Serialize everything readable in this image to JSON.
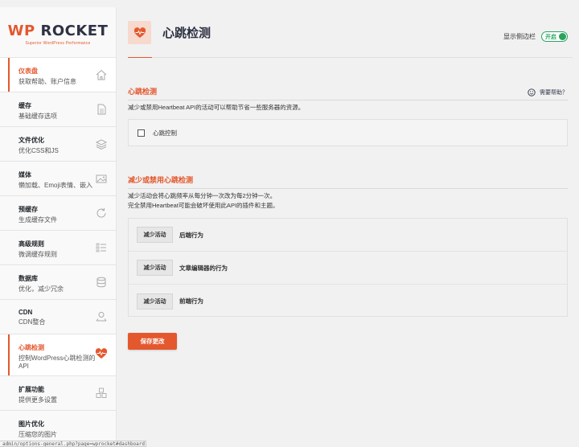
{
  "logo": {
    "main_wp": "WP",
    "main_rocket": "ROCKET",
    "sub": "Superior WordPress Performance"
  },
  "sidebar": {
    "items": [
      {
        "title": "仪表盘",
        "desc": "获取帮助、账户信息",
        "icon": "home-icon"
      },
      {
        "title": "缓存",
        "desc": "基础缓存选项",
        "icon": "file-icon"
      },
      {
        "title": "文件优化",
        "desc": "优化CSS和JS",
        "icon": "layers-icon"
      },
      {
        "title": "媒体",
        "desc": "懒加载、Emoji表情、嵌入",
        "icon": "image-icon"
      },
      {
        "title": "预缓存",
        "desc": "生成缓存文件",
        "icon": "refresh-icon"
      },
      {
        "title": "高级规则",
        "desc": "微调缓存规则",
        "icon": "list-icon"
      },
      {
        "title": "数据库",
        "desc": "优化，减少冗余",
        "icon": "database-icon"
      },
      {
        "title": "CDN",
        "desc": "CDN整合",
        "icon": "cdn-icon"
      },
      {
        "title": "心跳检测",
        "desc": "控制WordPress心跳检测的API",
        "icon": "heartbeat-icon"
      },
      {
        "title": "扩展功能",
        "desc": "提供更多设置",
        "icon": "addons-icon"
      },
      {
        "title": "图片优化",
        "desc": "压缩您的图片",
        "icon": ""
      }
    ]
  },
  "header": {
    "title": "心跳检测",
    "icon": "heartbeat-icon",
    "sidebar_toggle_label": "显示侧边栏",
    "sidebar_toggle_value": "开启"
  },
  "section1": {
    "title": "心跳检测",
    "help": "需要帮助？",
    "description": "减少或禁用Heartbeat API的活动可以帮助节省一些服务器的资源。",
    "checkbox_label": "心跳控制"
  },
  "section2": {
    "title": "减少或禁用心跳检测",
    "description_lines": [
      "减少活动会将心跳频率从每分钟一次改为每2分钟一次。",
      "完全禁用Heartbeat可能会破坏使用此API的插件和主题。"
    ],
    "rows": [
      {
        "button": "减少活动",
        "label": "后端行为"
      },
      {
        "button": "减少活动",
        "label": "文章编辑器的行为"
      },
      {
        "button": "减少活动",
        "label": "前端行为"
      }
    ]
  },
  "save_button": "保存更改",
  "status_url": "admin/options-general.php?page=wprocket#dashboard",
  "colors": {
    "accent": "#e4582e",
    "toggle_on": "#2aa35f"
  }
}
